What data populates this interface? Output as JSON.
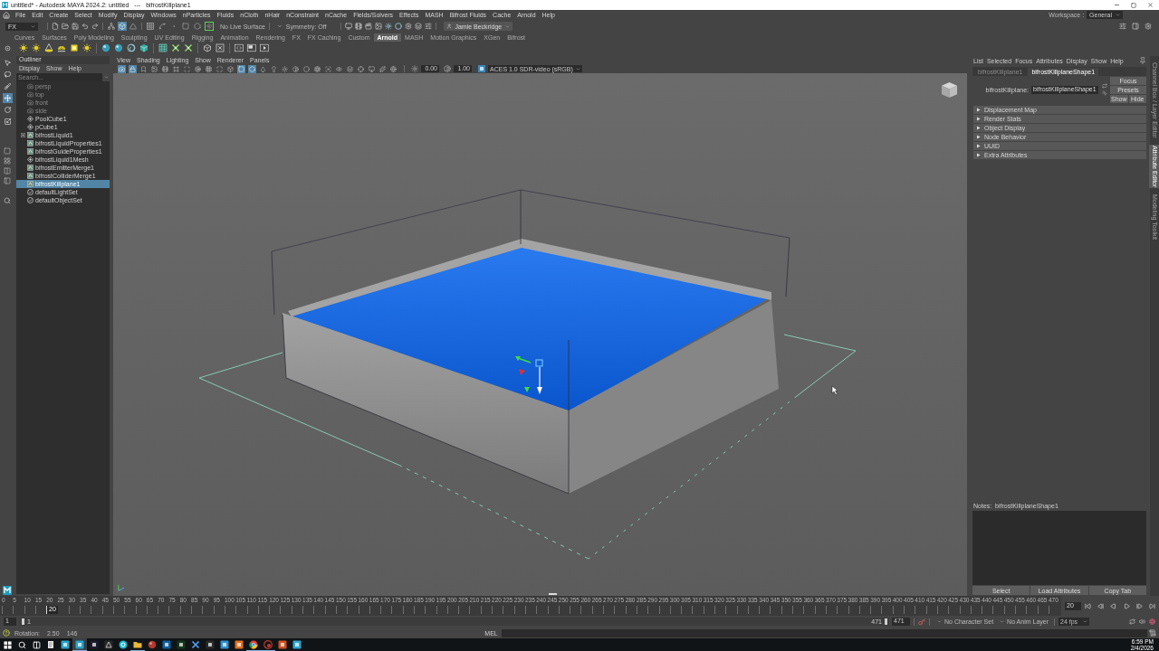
{
  "window": {
    "title": "untitled* - Autodesk MAYA 2024.2: untitled   ---   bifrostKillplane1"
  },
  "menu_bar": {
    "items": [
      "File",
      "Edit",
      "Create",
      "Select",
      "Modify",
      "Display",
      "Windows",
      "nParticles",
      "Fluids",
      "nCloth",
      "nHair",
      "nConstraint",
      "nCache",
      "Fields/Solvers",
      "Effects",
      "MASH",
      "Bifrost Fluids",
      "Cache",
      "Arnold",
      "Help"
    ],
    "workspace_label": "Workspace :",
    "workspace": "General"
  },
  "status_line": {
    "menu_set": "FX",
    "selection_modes": [
      {
        "kind": "hierarchy",
        "selected": false
      },
      {
        "kind": "object",
        "selected": true
      },
      {
        "kind": "component",
        "selected": false
      }
    ],
    "snap_toggles": [
      {
        "kind": "grid",
        "on": false
      },
      {
        "kind": "curve",
        "on": false
      },
      {
        "kind": "point",
        "on": false
      },
      {
        "kind": "plane",
        "on": false
      },
      {
        "kind": "surface",
        "on": false
      },
      {
        "kind": "magnet",
        "on": true
      }
    ],
    "live_surface": "No Live Surface",
    "symmetry": "Symmetry: Off",
    "account": "Jamie Beckridge"
  },
  "shelf": {
    "tabs": [
      {
        "label": "Curves",
        "selected": false
      },
      {
        "label": "Surfaces",
        "selected": false
      },
      {
        "label": "Poly Modeling",
        "selected": false
      },
      {
        "label": "Sculpting",
        "selected": false
      },
      {
        "label": "UV Editing",
        "selected": false
      },
      {
        "label": "Rigging",
        "selected": false
      },
      {
        "label": "Animation",
        "selected": false
      },
      {
        "label": "Rendering",
        "selected": false
      },
      {
        "label": "FX",
        "selected": false
      },
      {
        "label": "FX Caching",
        "selected": false
      },
      {
        "label": "Custom",
        "selected": false
      },
      {
        "label": "Arnold",
        "selected": true
      },
      {
        "label": "MASH",
        "selected": false
      },
      {
        "label": "Motion Graphics",
        "selected": false
      },
      {
        "label": "XGen",
        "selected": false
      },
      {
        "label": "Bifrost",
        "selected": false
      }
    ]
  },
  "toolbox": {
    "tools": [
      {
        "kind": "select",
        "selected": false
      },
      {
        "kind": "lasso",
        "selected": false
      },
      {
        "kind": "paint",
        "selected": false
      },
      {
        "kind": "move",
        "selected": true
      },
      {
        "kind": "rotate",
        "selected": false
      },
      {
        "kind": "scale",
        "selected": false
      }
    ]
  },
  "outliner": {
    "title": "Outliner",
    "menus": [
      "Display",
      "Show",
      "Help"
    ],
    "search_placeholder": "Search...",
    "items": [
      {
        "label": "persp",
        "kind": "camera",
        "selected": false
      },
      {
        "label": "top",
        "kind": "camera",
        "selected": false
      },
      {
        "label": "front",
        "kind": "camera",
        "selected": false
      },
      {
        "label": "side",
        "kind": "camera",
        "selected": false
      },
      {
        "label": "PoolCube1",
        "kind": "transform",
        "selected": false
      },
      {
        "label": "pCube1",
        "kind": "transform",
        "selected": false
      },
      {
        "label": "bifrostLiquid1",
        "kind": "bifrost",
        "selected": false,
        "expanded": false
      },
      {
        "label": "bifrostLiquidProperties1",
        "kind": "bifrost",
        "selected": false
      },
      {
        "label": "bifrostGuideProperties1",
        "kind": "bifrost",
        "selected": false
      },
      {
        "label": "bifrostLiquid1Mesh",
        "kind": "transform",
        "selected": false
      },
      {
        "label": "bifrostEmitterMerge1",
        "kind": "bifrost",
        "selected": false
      },
      {
        "label": "bifrostColliderMerge1",
        "kind": "bifrost",
        "selected": false
      },
      {
        "label": "bifrostKillplane1",
        "kind": "bifrost",
        "selected": true
      },
      {
        "label": "defaultLightSet",
        "kind": "set",
        "selected": false
      },
      {
        "label": "defaultObjectSet",
        "kind": "set",
        "selected": false
      }
    ]
  },
  "viewport": {
    "menus": [
      "View",
      "Shading",
      "Lighting",
      "Show",
      "Renderer",
      "Panels"
    ],
    "toolbar": [
      {
        "kind": "camera",
        "on": true
      },
      {
        "kind": "lock",
        "on": true
      },
      {
        "kind": "bookmark",
        "on": false
      },
      {
        "kind": "image",
        "on": false
      },
      {
        "kind": "film",
        "on": false
      },
      {
        "kind": "frame",
        "on": false
      },
      {
        "kind": "scan",
        "on": false
      },
      {
        "kind": "target",
        "on": false
      },
      {
        "kind": "grid",
        "on": false
      },
      {
        "kind": "maximize",
        "on": false
      },
      {
        "kind": "cube",
        "on": false
      },
      {
        "kind": "square",
        "on": true
      },
      {
        "kind": "hexagon",
        "on": true
      },
      {
        "kind": "droplet",
        "on": false
      },
      {
        "kind": "lightbulb",
        "on": false
      },
      {
        "kind": "sun",
        "on": false
      },
      {
        "kind": "contrast",
        "on": false
      },
      {
        "kind": "circle",
        "on": false
      },
      {
        "kind": "aperture",
        "on": false
      },
      {
        "kind": "focus",
        "on": false
      },
      {
        "kind": "eye",
        "on": false
      },
      {
        "kind": "layers",
        "on": false
      },
      {
        "kind": "crosshair",
        "on": false
      },
      {
        "kind": "monitor",
        "on": false
      },
      {
        "kind": "sparkles",
        "on": false
      },
      {
        "kind": "globe",
        "on": false
      }
    ],
    "exposure": "0.00",
    "gamma": "1.00",
    "color_space": "ACES 1.0 SDR-video (sRGB)"
  },
  "attribute_editor": {
    "menus": [
      "List",
      "Selected",
      "Focus",
      "Attributes",
      "Display",
      "Show",
      "Help"
    ],
    "tabs": [
      {
        "label": "bifrostKillplane1",
        "selected": false
      },
      {
        "label": "bifrostKillplaneShape1",
        "selected": true
      }
    ],
    "node_label": "bifrostKillplane:",
    "node_value": "bifrostKillplaneShape1",
    "buttons": [
      "Focus",
      "Presets",
      "Show",
      "Hide"
    ],
    "sections": [
      {
        "label": "Displacement Map",
        "expanded": false
      },
      {
        "label": "Render Stats",
        "expanded": false
      },
      {
        "label": "Object Display",
        "expanded": false
      },
      {
        "label": "Node Behavior",
        "expanded": false
      },
      {
        "label": "UUID",
        "expanded": false
      },
      {
        "label": "Extra Attributes",
        "expanded": false
      }
    ],
    "notes_label": "Notes:  bifrostKillplaneShape1",
    "footer_buttons": [
      "Select",
      "Load Attributes",
      "Copy Tab"
    ]
  },
  "side_tabs": [
    {
      "label": "Channel Box / Layer Editor",
      "selected": false
    },
    {
      "label": "Attribute Editor",
      "selected": true
    },
    {
      "label": "Modeling Toolkit",
      "selected": false
    }
  ],
  "timeline": {
    "tick_labels": [
      "0",
      "5",
      "10",
      "15",
      "20",
      "25",
      "30",
      "35",
      "40",
      "45",
      "50",
      "55",
      "60",
      "65",
      "70",
      "75",
      "80",
      "85",
      "90",
      "95",
      "100",
      "105",
      "110",
      "115",
      "120",
      "125",
      "130",
      "135",
      "140",
      "145",
      "150",
      "155",
      "160",
      "165",
      "170",
      "175",
      "180",
      "185",
      "190",
      "195",
      "200",
      "205",
      "210",
      "215",
      "220",
      "225",
      "230",
      "235",
      "240",
      "245",
      "250",
      "255",
      "260",
      "265",
      "270",
      "275",
      "280",
      "285",
      "290",
      "295",
      "300",
      "305",
      "310",
      "315",
      "320",
      "325",
      "330",
      "335",
      "340",
      "345",
      "350",
      "355",
      "360",
      "365",
      "370",
      "375",
      "380",
      "385",
      "390",
      "395",
      "400",
      "405",
      "410",
      "415",
      "420",
      "425",
      "430",
      "435",
      "440",
      "445",
      "450",
      "455",
      "460",
      "465",
      "470"
    ],
    "level": 0.042,
    "current_frame": "20",
    "frame_field": "20"
  },
  "range_slider": {
    "start": "1",
    "range_start": "1",
    "range_end": "471",
    "end": "471",
    "character_set": "No Character Set",
    "anim_layer": "No Anim Layer",
    "fps": "24 fps"
  },
  "help_line": {
    "label": "Rotation:",
    "values": [
      "2.50",
      "146"
    ]
  },
  "command_line": {
    "language": "MEL"
  },
  "taskbar": {
    "apps": [
      {
        "running": false,
        "selected": false
      },
      {
        "running": false,
        "selected": false
      },
      {
        "running": true,
        "selected": true
      },
      {
        "running": false,
        "selected": false
      },
      {
        "running": false,
        "selected": false
      },
      {
        "running": false,
        "selected": false
      },
      {
        "running": true,
        "selected": false
      },
      {
        "running": false,
        "selected": false
      },
      {
        "running": false,
        "selected": false
      },
      {
        "running": false,
        "selected": false
      },
      {
        "running": false,
        "selected": false
      },
      {
        "running": false,
        "selected": false
      },
      {
        "running": false,
        "selected": false
      },
      {
        "running": false,
        "selected": false
      },
      {
        "running": true,
        "selected": false
      },
      {
        "running": true,
        "selected": false
      },
      {
        "running": false,
        "selected": false
      },
      {
        "running": false,
        "selected": false
      }
    ],
    "time": "6:59 PM",
    "date": "2/4/2026"
  }
}
